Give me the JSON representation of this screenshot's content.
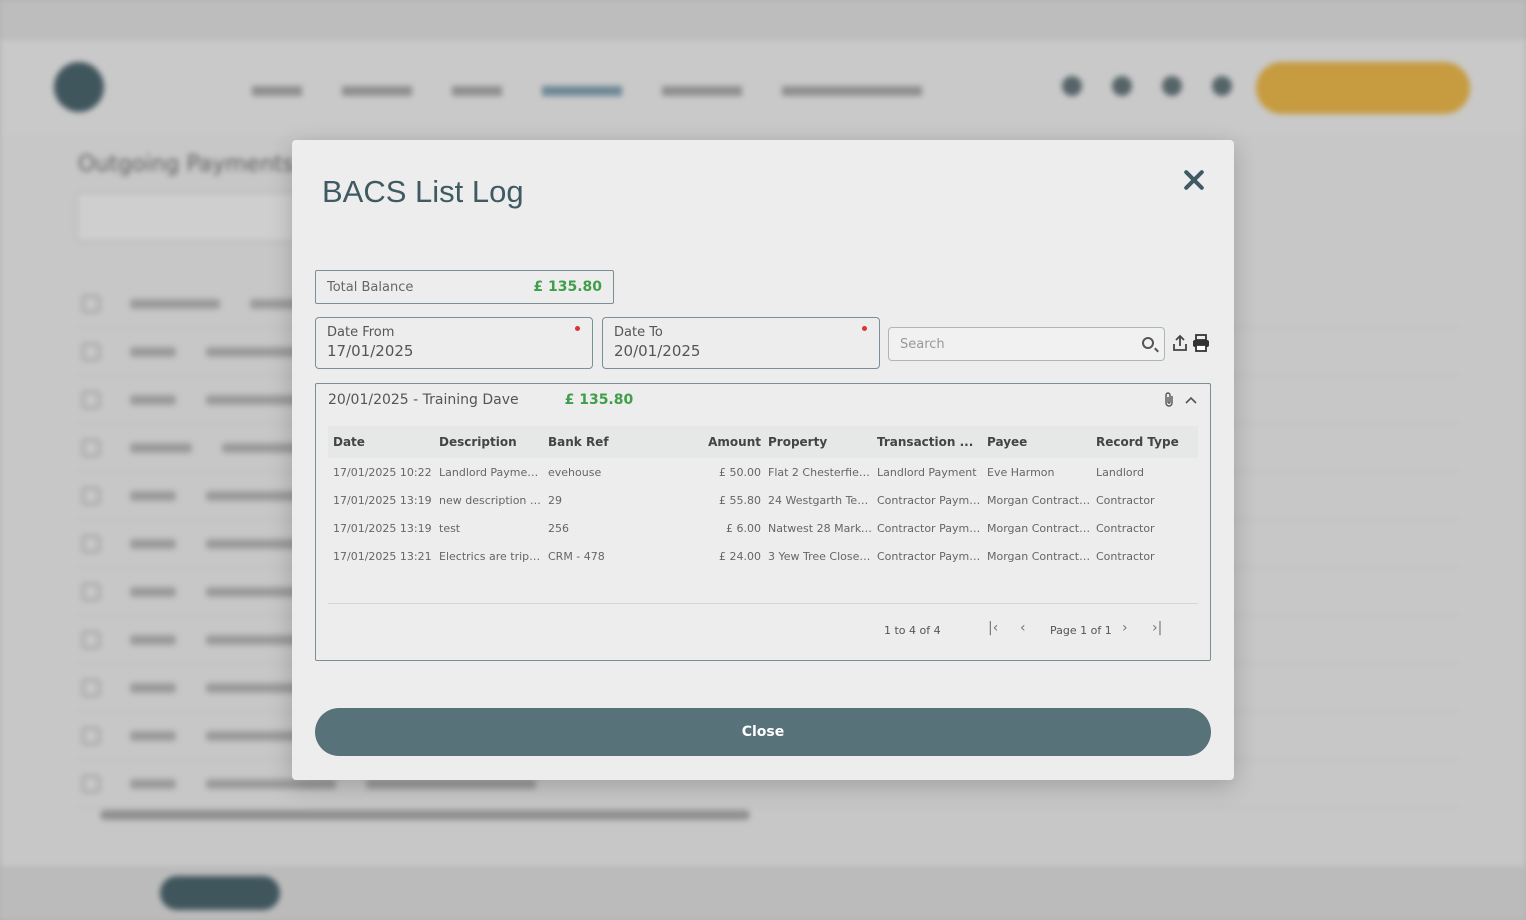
{
  "background": {
    "top_links": [
      "",
      "",
      "",
      ""
    ],
    "page_title": "Outgoing Payments"
  },
  "modal": {
    "title": "BACS List Log",
    "total_balance": {
      "label": "Total Balance",
      "value": "£ 135.80"
    },
    "date_from": {
      "label": "Date From",
      "value": "17/01/2025"
    },
    "date_to": {
      "label": "Date To",
      "value": "20/01/2025"
    },
    "search": {
      "placeholder": "Search"
    },
    "log": {
      "heading": "20/01/2025 - Training Dave",
      "amount": "£ 135.80",
      "columns": [
        "Date",
        "Description",
        "Bank Ref",
        "Amount",
        "Property",
        "Transaction ...",
        "Payee",
        "Record Type"
      ],
      "rows": [
        [
          "17/01/2025 10:22",
          "Landlord Payment...",
          "evehouse",
          "£ 50.00",
          "Flat 2 Chesterfiel...",
          "Landlord Payment",
          "Eve Harmon",
          "Landlord"
        ],
        [
          "17/01/2025 13:19",
          "new description i...",
          "29",
          "£ 55.80",
          "24 Westgarth Terr...",
          "Contractor Payme...",
          "Morgan Contracti...",
          "Contractor"
        ],
        [
          "17/01/2025 13:19",
          "test",
          "256",
          "£ 6.00",
          "Natwest 28 Marke...",
          "Contractor Payme...",
          "Morgan Contracti...",
          "Contractor"
        ],
        [
          "17/01/2025 13:21",
          "Electrics are tripp...",
          "CRM - 478",
          "£ 24.00",
          "3 Yew Tree Close,...",
          "Contractor Payme...",
          "Morgan Contracti...",
          "Contractor"
        ]
      ],
      "pager": {
        "count": "1 to 4 of 4",
        "page": "Page 1 of 1"
      }
    },
    "close_label": "Close"
  },
  "colors": {
    "accent": "#58727a",
    "positive": "#3f9e4a",
    "title": "#3f5a63"
  }
}
